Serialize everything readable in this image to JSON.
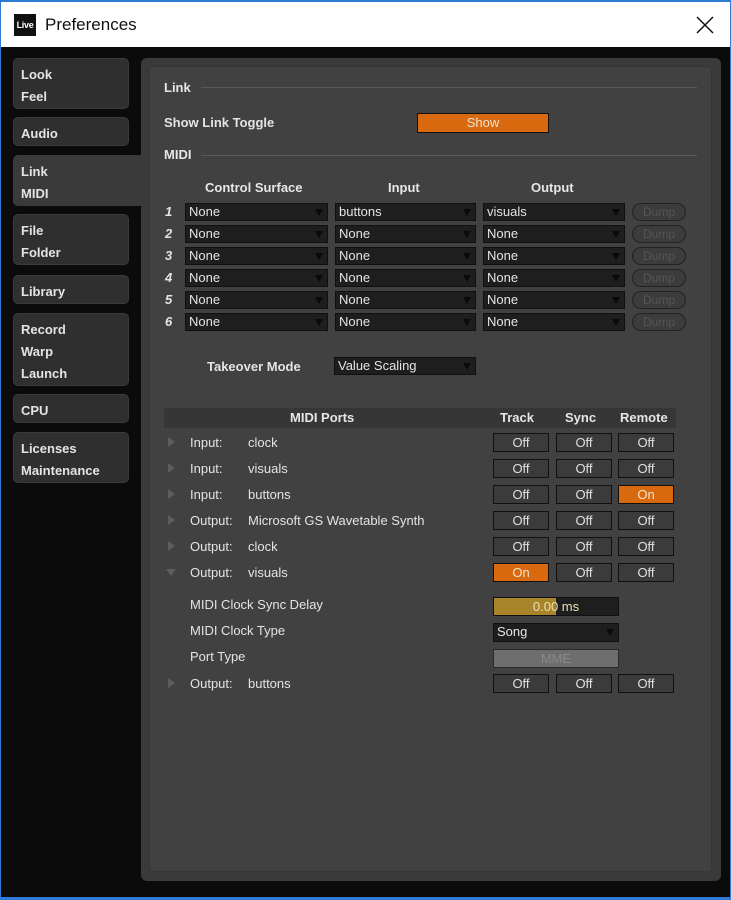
{
  "window": {
    "app_logo": "Live",
    "title": "Preferences",
    "close_icon": "close-icon"
  },
  "sidebar": {
    "tabs": [
      {
        "id": "look-feel",
        "lines": [
          "Look",
          "Feel"
        ],
        "active": false
      },
      {
        "id": "audio",
        "lines": [
          "Audio"
        ],
        "active": false
      },
      {
        "id": "link-midi",
        "lines": [
          "Link",
          "MIDI"
        ],
        "active": true
      },
      {
        "id": "file-folder",
        "lines": [
          "File",
          "Folder"
        ],
        "active": false
      },
      {
        "id": "library",
        "lines": [
          "Library"
        ],
        "active": false
      },
      {
        "id": "record-warp-launch",
        "lines": [
          "Record",
          "Warp",
          "Launch"
        ],
        "active": false
      },
      {
        "id": "cpu",
        "lines": [
          "CPU"
        ],
        "active": false
      },
      {
        "id": "licenses-maintenance",
        "lines": [
          "Licenses",
          "Maintenance"
        ],
        "active": false
      }
    ]
  },
  "link": {
    "section_title": "Link",
    "show_link_toggle_label": "Show Link Toggle",
    "show_link_toggle_value": "Show"
  },
  "midi": {
    "section_title": "MIDI",
    "columns": {
      "control_surface": "Control Surface",
      "input": "Input",
      "output": "Output"
    },
    "surfaces": [
      {
        "num": "1",
        "control_surface": "None",
        "input": "buttons",
        "output": "visuals",
        "dump": "Dump"
      },
      {
        "num": "2",
        "control_surface": "None",
        "input": "None",
        "output": "None",
        "dump": "Dump"
      },
      {
        "num": "3",
        "control_surface": "None",
        "input": "None",
        "output": "None",
        "dump": "Dump"
      },
      {
        "num": "4",
        "control_surface": "None",
        "input": "None",
        "output": "None",
        "dump": "Dump"
      },
      {
        "num": "5",
        "control_surface": "None",
        "input": "None",
        "output": "None",
        "dump": "Dump"
      },
      {
        "num": "6",
        "control_surface": "None",
        "input": "None",
        "output": "None",
        "dump": "Dump"
      }
    ],
    "takeover_mode_label": "Takeover Mode",
    "takeover_mode_value": "Value Scaling"
  },
  "ports": {
    "headers": {
      "ports": "MIDI Ports",
      "track": "Track",
      "sync": "Sync",
      "remote": "Remote"
    },
    "rows": [
      {
        "type": "Input:",
        "name": "clock",
        "expanded": false,
        "track": "Off",
        "sync": "Off",
        "remote": "Off"
      },
      {
        "type": "Input:",
        "name": "visuals",
        "expanded": false,
        "track": "Off",
        "sync": "Off",
        "remote": "Off"
      },
      {
        "type": "Input:",
        "name": "buttons",
        "expanded": false,
        "track": "Off",
        "sync": "Off",
        "remote": "On"
      },
      {
        "type": "Output:",
        "name": "Microsoft GS Wavetable Synth",
        "expanded": false,
        "track": "Off",
        "sync": "Off",
        "remote": "Off"
      },
      {
        "type": "Output:",
        "name": "clock",
        "expanded": false,
        "track": "Off",
        "sync": "Off",
        "remote": "Off"
      },
      {
        "type": "Output:",
        "name": "visuals",
        "expanded": true,
        "track": "On",
        "sync": "Off",
        "remote": "Off"
      }
    ],
    "expanded_details": {
      "sync_delay_label": "MIDI Clock Sync Delay",
      "sync_delay_value": "0.00 ms",
      "sync_delay_fill_fraction": 0.5,
      "clock_type_label": "MIDI Clock Type",
      "clock_type_value": "Song",
      "port_type_label": "Port Type",
      "port_type_value": "MME"
    },
    "last_row": {
      "type": "Output:",
      "name": "buttons",
      "expanded": false,
      "track": "Off",
      "sync": "Off",
      "remote": "Off"
    }
  },
  "colors": {
    "accent_orange": "#d9690e",
    "slider_gold": "#a8842a",
    "panel_bg": "#414141",
    "window_border": "#2d7bd4"
  }
}
